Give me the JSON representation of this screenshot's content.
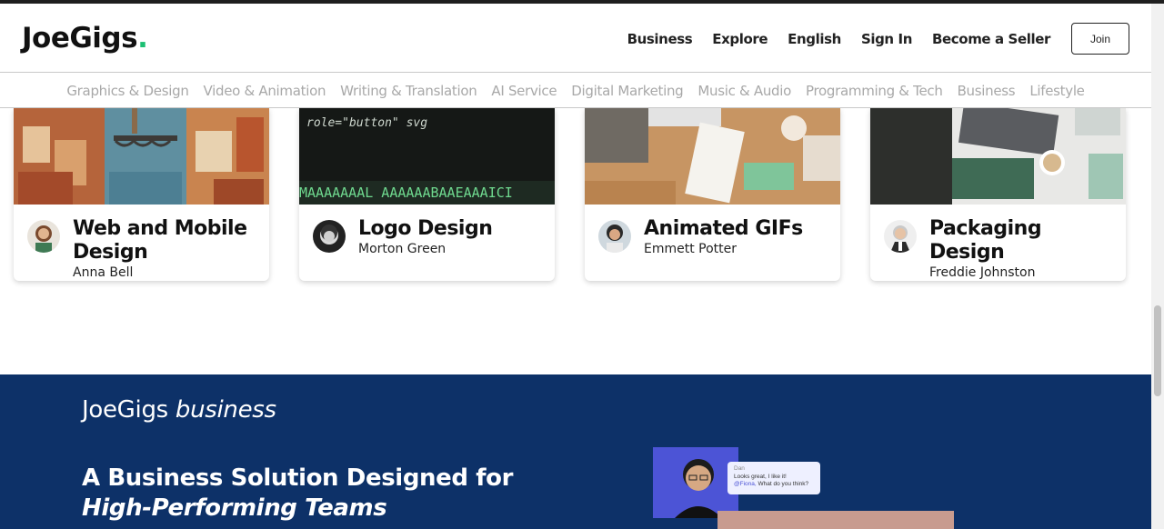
{
  "header": {
    "logo_text": "JoeGigs",
    "logo_dot": ".",
    "nav": [
      "Business",
      "Explore",
      "English",
      "Sign In",
      "Become a Seller"
    ],
    "join_label": "Join"
  },
  "categories": [
    "Graphics & Design",
    "Video & Animation",
    "Writing & Translation",
    "AI Service",
    "Digital Marketing",
    "Music & Audio",
    "Programming & Tech",
    "Business",
    "Lifestyle"
  ],
  "cards": [
    {
      "title": "Web and Mobile Design",
      "author": "Anna Bell"
    },
    {
      "title": "Logo Design",
      "author": "Morton Green"
    },
    {
      "title": "Animated GIFs",
      "author": "Emmett Potter"
    },
    {
      "title": "Packaging Design",
      "author": "Freddie Johnston"
    }
  ],
  "code_snippet": {
    "line1": "role=\"button\" svg",
    "line2": "MAAAAAAAL AAAAAABAAEAAAICI"
  },
  "business": {
    "brand_plain": "JoeGigs",
    "brand_italic": "business",
    "headline_plain": "A Business Solution Designed for",
    "headline_italic": "High-Performing Teams",
    "chat_name": "Dan",
    "chat_line1": "Looks great, I like it!",
    "chat_mention": "@Fiona,",
    "chat_line2": "What do you think?"
  },
  "colors": {
    "brand_green": "#1dbf73",
    "business_bg": "#0d3168",
    "category_text": "#a8a8a8"
  }
}
